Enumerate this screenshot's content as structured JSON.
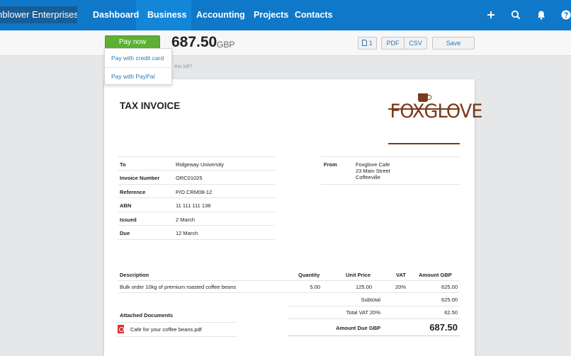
{
  "nav": {
    "org": "nblower Enterprises",
    "items": [
      "Dashboard",
      "Business",
      "Accounting",
      "Projects",
      "Contacts"
    ],
    "active": "Business"
  },
  "toolbar": {
    "pay_now": "Pay now",
    "amount": "687.50",
    "currency": "GBP",
    "attachments_count": "1",
    "pdf": "PDF",
    "csv": "CSV",
    "save": "Save"
  },
  "pay_menu": {
    "items": [
      "Pay with credit card",
      "Pay with PayPal"
    ]
  },
  "hint": "this bill?",
  "invoice": {
    "title": "TAX INVOICE",
    "logo_text": "FOXGLOVE",
    "details": [
      {
        "label": "To",
        "value": "Ridgeway University"
      },
      {
        "label": "Invoice Number",
        "value": "ORC01025"
      },
      {
        "label": "Reference",
        "value": "P/O CRM08-12"
      },
      {
        "label": "ABN",
        "value": "11 111 111 138"
      },
      {
        "label": "Issued",
        "value": "2 March"
      },
      {
        "label": "Due",
        "value": "12 March"
      }
    ],
    "from": {
      "label": "From",
      "lines": [
        "Foxglove Cafe",
        "23 Main Street",
        "Coffeeville"
      ]
    },
    "columns": [
      "Description",
      "Quantity",
      "Unit Price",
      "VAT",
      "Amount GBP"
    ],
    "lines": [
      {
        "description": "Bulk order 10kg of premium roasted coffee beans",
        "quantity": "5.00",
        "unit_price": "125.00",
        "vat": "20%",
        "amount": "625.00"
      }
    ],
    "subtotal_label": "Subtotal",
    "subtotal": "625.00",
    "vat_label": "Total VAT 20%",
    "vat": "62.50",
    "due_label": "Amount Due GBP",
    "due": "687.50",
    "attached_label": "Attached Documents",
    "attachment": "Cafe for your coffee beans.pdf"
  },
  "colors": {
    "nav": "#0f78c8",
    "pay_green": "#5cb033",
    "logo_brown": "#7a3a1c",
    "link_blue": "#2a78b8"
  }
}
